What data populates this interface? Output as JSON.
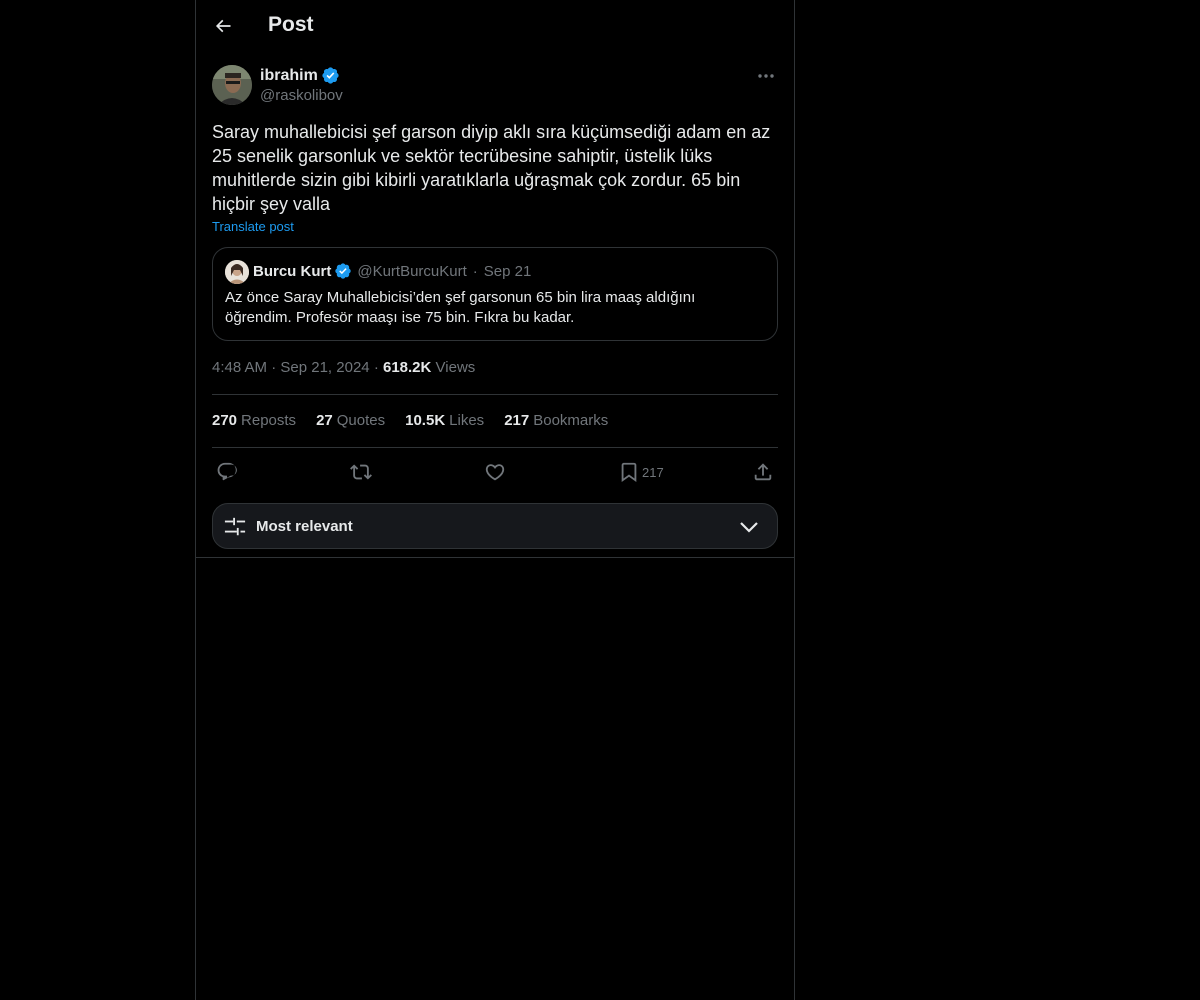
{
  "header": {
    "title": "Post"
  },
  "post": {
    "author_name": "ibrahim",
    "author_handle": "@raskolibov",
    "verified": true,
    "text": "Saray muhallebicisi şef garson diyip aklı sıra küçümsediği adam en az 25 senelik garsonluk ve sektör tecrübesine sahiptir, üstelik lüks muhitlerde sizin gibi kibirli yaratıklarla uğraşmak çok zordur. 65 bin hiçbir şey valla",
    "translate_label": "Translate post",
    "time": "4:48 AM",
    "date": "Sep 21, 2024",
    "views_count": "618.2K",
    "views_label": "Views"
  },
  "quote": {
    "name": "Burcu Kurt",
    "handle": "@KurtBurcuKurt",
    "separator": "·",
    "date": "Sep 21",
    "verified": true,
    "text": "Az önce Saray Muhallebicisi’den şef garsonun 65 bin lira maaş aldığını öğrendim. Profesör maaşı ise 75 bin. Fıkra bu kadar."
  },
  "stats": {
    "reposts_count": "270",
    "reposts_label": "Reposts",
    "quotes_count": "27",
    "quotes_label": "Quotes",
    "likes_count": "10.5K",
    "likes_label": "Likes",
    "bookmarks_count": "217",
    "bookmarks_label": "Bookmarks"
  },
  "actions": {
    "reply_icon": "reply-icon",
    "repost_icon": "repost-icon",
    "like_icon": "heart-icon",
    "bookmark_icon": "bookmark-icon",
    "bookmark_count": "217",
    "share_icon": "share-icon"
  },
  "sort": {
    "label": "Most relevant",
    "icon": "sliders-icon",
    "chevron": "chevron-down-icon"
  },
  "colors": {
    "background": "#000000",
    "text_primary": "#e7e9ea",
    "text_secondary": "#71767b",
    "accent": "#1d9bf0",
    "border": "#2f3336",
    "sort_bg": "#16181c"
  }
}
